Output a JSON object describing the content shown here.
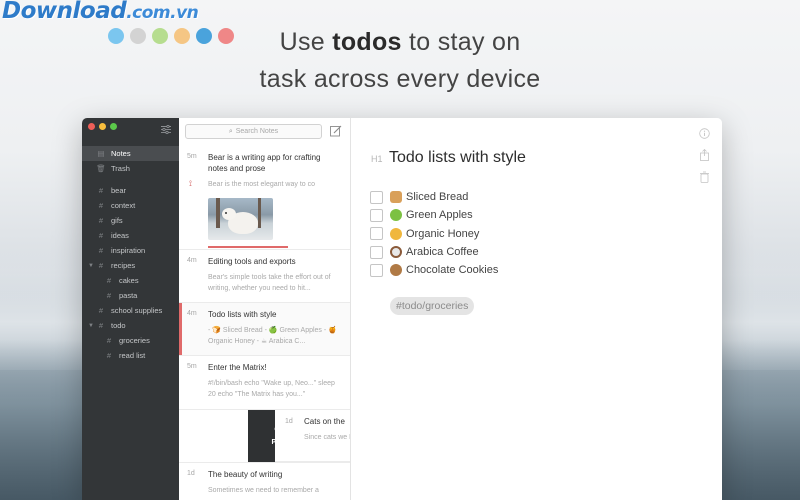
{
  "watermark": {
    "brand": "Download",
    "domain": ".com.vn"
  },
  "dots": [
    "#7bc6ef",
    "#d3d3d3",
    "#b6dd8f",
    "#f5c684",
    "#4aa3dc",
    "#ef8787"
  ],
  "headline": {
    "pre": "Use ",
    "bold": "todos",
    "post": " to stay on",
    "line2": "task across every device"
  },
  "sidebar": {
    "items": [
      {
        "label": "Notes",
        "icon": "notes-icon"
      },
      {
        "label": "Trash",
        "icon": "trash-icon"
      }
    ],
    "tags": [
      {
        "label": "bear"
      },
      {
        "label": "context"
      },
      {
        "label": "gifs"
      },
      {
        "label": "ideas"
      },
      {
        "label": "inspiration"
      },
      {
        "label": "recipes"
      },
      {
        "label": "cakes"
      },
      {
        "label": "pasta"
      },
      {
        "label": "school supplies"
      },
      {
        "label": "todo"
      },
      {
        "label": "groceries"
      },
      {
        "label": "read list"
      }
    ]
  },
  "notes": {
    "search_placeholder": "Search Notes",
    "list": [
      {
        "age": "5m",
        "title": "Bear is a writing app for crafting notes and prose",
        "excerpt": "Bear is the most elegant way to co"
      },
      {
        "age": "4m",
        "title": "Editing tools and exports",
        "excerpt": "Bear's simple tools take the effort out of writing, whether you need to hit..."
      },
      {
        "age": "4m",
        "title": "Todo lists with style",
        "excerpt": "- 🍞 Sliced Bread - 🍏 Green Apples - 🍯 Organic Honey - ☕ Arabica C..."
      },
      {
        "age": "5m",
        "title": "Enter the Matrix!",
        "excerpt": "#!/bin/bash echo \"Wake up, Neo...\" sleep 20 echo \"The Matrix has you...\""
      },
      {
        "age": "1d",
        "title": "Cats on the",
        "excerpt": "Since cats we Egypt, they have"
      },
      {
        "age": "1d",
        "title": "The beauty of writing",
        "excerpt": "Sometimes we need to remember a"
      }
    ],
    "pin_label": "Pin"
  },
  "editor": {
    "heading_marker": "H1",
    "title": "Todo lists with style",
    "todos": [
      {
        "label": "Sliced Bread",
        "emoji_color": "#d9a05a"
      },
      {
        "label": "Green Apples",
        "emoji_color": "#7cc142"
      },
      {
        "label": "Organic Honey",
        "emoji_color": "#f0b73d"
      },
      {
        "label": "Arabica Coffee",
        "emoji_color": "#8a5a3a"
      },
      {
        "label": "Chocolate Cookies",
        "emoji_color": "#b07a45"
      }
    ],
    "tag": "#todo/groceries"
  }
}
